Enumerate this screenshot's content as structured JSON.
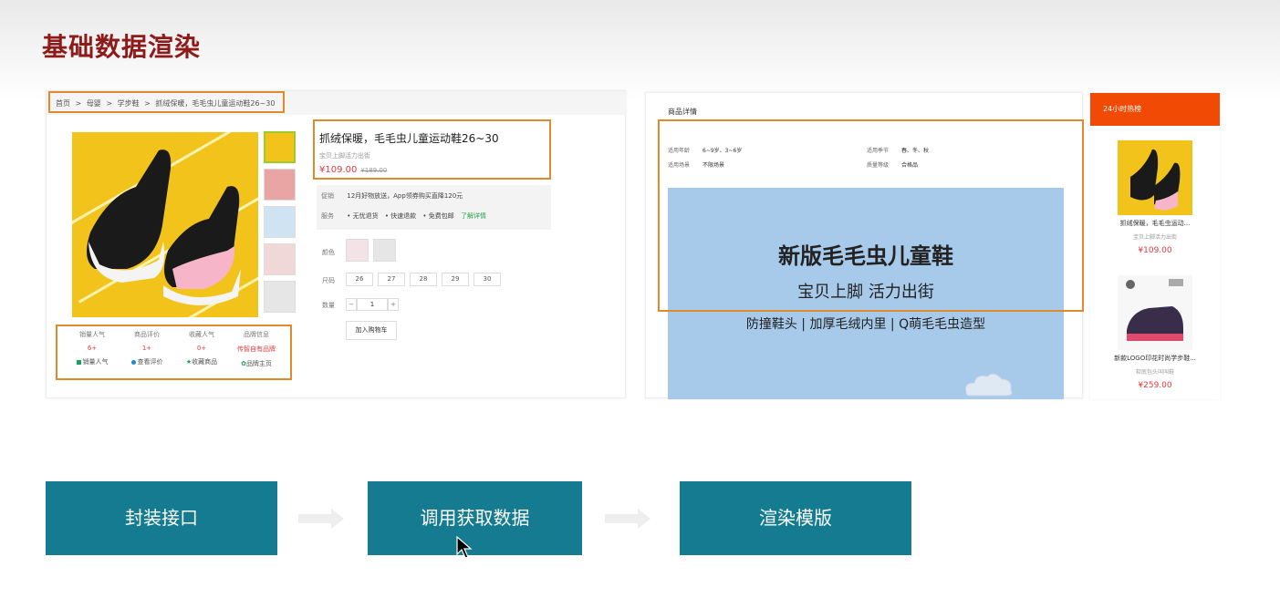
{
  "slide": {
    "title": "基础数据渲染"
  },
  "breadcrumb": [
    "首页",
    ">",
    "母婴",
    ">",
    "学步鞋",
    ">",
    "抓绒保暖，毛毛虫儿童运动鞋26~30"
  ],
  "product": {
    "title": "抓绒保暖，毛毛虫儿童运动鞋26~30",
    "subtitle": "宝贝上脚活力出街",
    "price": "¥109.00",
    "old_price": "¥189.00"
  },
  "stats": [
    {
      "label": "销量人气",
      "value": "6+",
      "action": "销量人气",
      "icon_color": "#19a15f"
    },
    {
      "label": "商品评价",
      "value": "1+",
      "action": "查看评价",
      "icon_color": "#1b88d8"
    },
    {
      "label": "收藏人气",
      "value": "0+",
      "action": "收藏商品",
      "icon_color": "#19a15f"
    },
    {
      "label": "品牌信息",
      "value": "传智自有品牌",
      "action": "品牌主页",
      "icon_color": "#19a15f"
    }
  ],
  "promo": {
    "promo_label": "促销",
    "promo_text": "12月好物放送，App领券购买直降120元",
    "service_label": "服务",
    "services": [
      "• 无忧退货",
      "• 快速退款",
      "• 免费包邮"
    ],
    "service_link": "了解详情"
  },
  "options": {
    "color_label": "颜色",
    "size_label": "尺码",
    "sizes": [
      "26",
      "27",
      "28",
      "29",
      "30"
    ],
    "qty_label": "数量",
    "qty_minus": "−",
    "qty_value": "1",
    "qty_plus": "+",
    "cart_button": "加入购物车"
  },
  "detail": {
    "heading": "商品详情",
    "specs": [
      {
        "label": "适用年龄",
        "value": "6~9岁、3~6岁"
      },
      {
        "label": "适用季节",
        "value": "春、冬、秋"
      },
      {
        "label": "适用场景",
        "value": "不限场景"
      },
      {
        "label": "质量等级",
        "value": "合格品"
      }
    ],
    "banner_title": "新版毛毛虫儿童鞋",
    "banner_subtitle": "宝贝上脚 活力出街",
    "banner_features": "防撞鞋头 | 加厚毛绒内里 | Q萌毛毛虫造型"
  },
  "hot": {
    "heading": "24小时热榜",
    "items": [
      {
        "title": "抓绒保暖，毛毛虫运动...",
        "sub": "宝贝上脚活力出街",
        "price": "¥109.00"
      },
      {
        "title": "新款LOGO印花时尚学步鞋...",
        "sub": "软底包头叫叫鞋",
        "price": "¥259.00"
      }
    ]
  },
  "flow": [
    "封装接口",
    "调用获取数据",
    "渲染模版"
  ],
  "colors": {
    "title": "#8e1a1a",
    "highlight": "#e08a2e",
    "flow": "#147b90",
    "hot": "#f04a04",
    "price": "#e4393c"
  }
}
